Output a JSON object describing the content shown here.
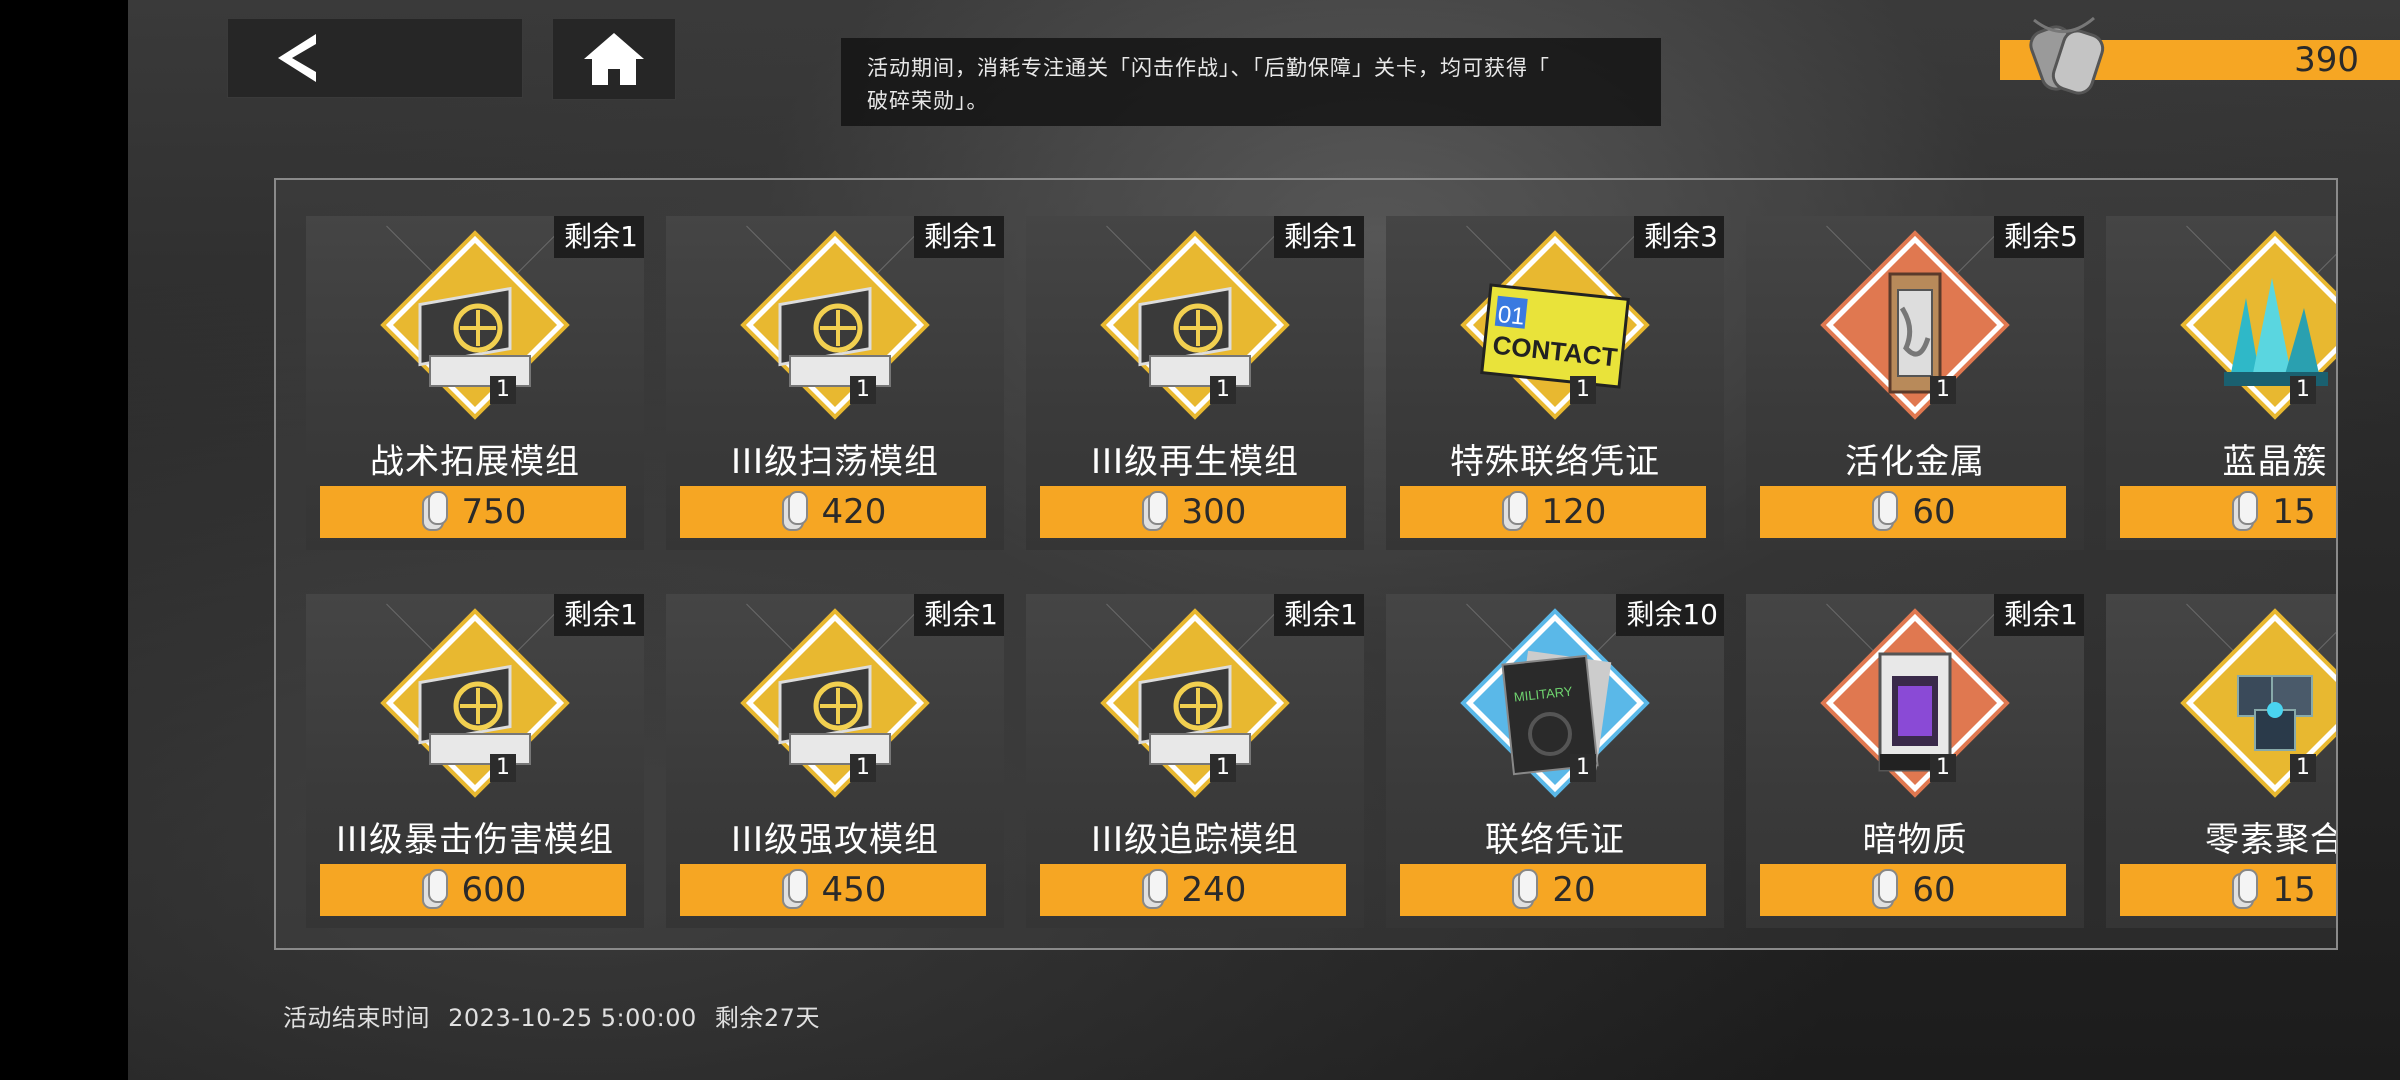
{
  "notice": {
    "line1": "活动期间，消耗专注通关「闪击作战」、「后勤保障」关卡，均可获得「",
    "line2": "破碎荣勋」。"
  },
  "currency": {
    "amount": "390",
    "icon": "dog-tags-icon"
  },
  "colors": {
    "accent": "#f6a623",
    "gold": "#e8b830",
    "blue": "#5ab8e8",
    "red": "#e07850"
  },
  "items": [
    {
      "stock": "剩余1",
      "name": "战术拓展模组",
      "price": "750",
      "qty": "1",
      "icon": "module-case-icon",
      "frame": "gold"
    },
    {
      "stock": "剩余1",
      "name": "III级扫荡模组",
      "price": "420",
      "qty": "1",
      "icon": "module-case-icon",
      "frame": "gold"
    },
    {
      "stock": "剩余1",
      "name": "III级再生模组",
      "price": "300",
      "qty": "1",
      "icon": "module-case-icon",
      "frame": "gold"
    },
    {
      "stock": "剩余3",
      "name": "特殊联络凭证",
      "price": "120",
      "qty": "1",
      "icon": "contact-card-icon",
      "frame": "gold",
      "card_text": "01 CONTACT"
    },
    {
      "stock": "剩余5",
      "name": "活化金属",
      "price": "60",
      "qty": "1",
      "icon": "metal-canister-icon",
      "frame": "red"
    },
    {
      "stock": "",
      "name": "蓝晶簇",
      "price": "15",
      "qty": "1",
      "icon": "crystal-cluster-icon",
      "frame": "gold"
    },
    {
      "stock": "剩余1",
      "name": "III级暴击伤害模组",
      "price": "600",
      "qty": "1",
      "icon": "module-case-icon",
      "frame": "gold"
    },
    {
      "stock": "剩余1",
      "name": "III级强攻模组",
      "price": "450",
      "qty": "1",
      "icon": "module-case-icon",
      "frame": "gold"
    },
    {
      "stock": "剩余1",
      "name": "III级追踪模组",
      "price": "240",
      "qty": "1",
      "icon": "module-case-icon",
      "frame": "gold"
    },
    {
      "stock": "剩余10",
      "name": "联络凭证",
      "price": "20",
      "qty": "1",
      "icon": "military-document-icon",
      "frame": "blue"
    },
    {
      "stock": "剩余1",
      "name": "暗物质",
      "price": "60",
      "qty": "1",
      "icon": "dark-matter-device-icon",
      "frame": "red"
    },
    {
      "stock": "",
      "name": "零素聚合",
      "price": "15",
      "qty": "1",
      "icon": "cube-cluster-icon",
      "frame": "gold"
    }
  ],
  "footer": {
    "label": "活动结束时间",
    "datetime": "2023-10-25 5:00:00",
    "remaining": "剩余27天"
  }
}
